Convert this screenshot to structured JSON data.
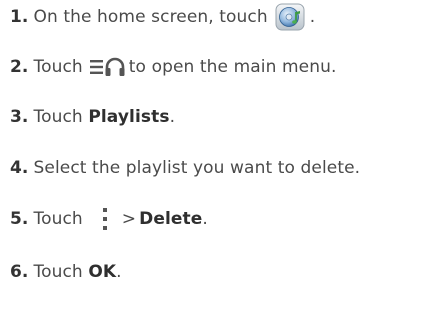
{
  "steps": [
    {
      "num": "1.",
      "parts": [
        "On the home screen, touch",
        "."
      ]
    },
    {
      "num": "2.",
      "parts": [
        "Touch",
        "to open the main menu."
      ]
    },
    {
      "num": "3.",
      "parts": [
        "Touch",
        "Playlists",
        "."
      ]
    },
    {
      "num": "4.",
      "parts": [
        "Select the playlist you want to delete."
      ]
    },
    {
      "num": "5.",
      "parts": [
        "Touch",
        ">",
        "Delete",
        "."
      ]
    },
    {
      "num": "6.",
      "parts": [
        "Touch",
        "OK",
        "."
      ]
    }
  ],
  "icons": {
    "step1": "music-app-icon",
    "step2": "menu-headphones-icon",
    "step5": "more-options-icon"
  },
  "colors": {
    "text": "#4a4a4a",
    "icon_dark": "#555555",
    "music_icon_blue": "#3a86c8",
    "music_icon_green": "#4caf50"
  }
}
